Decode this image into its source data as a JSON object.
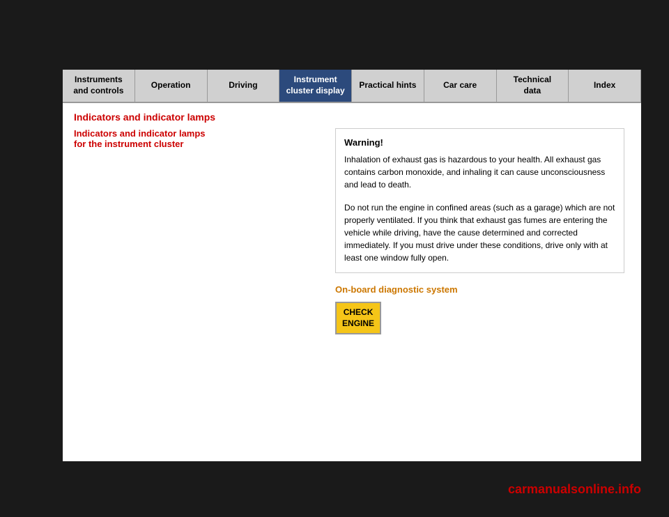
{
  "nav": {
    "items": [
      {
        "id": "instruments",
        "label": "Instruments\nand controls",
        "active": false
      },
      {
        "id": "operation",
        "label": "Operation",
        "active": false
      },
      {
        "id": "driving",
        "label": "Driving",
        "active": false
      },
      {
        "id": "instrument-cluster",
        "label": "Instrument\ncluster display",
        "active": true
      },
      {
        "id": "practical-hints",
        "label": "Practical hints",
        "active": false
      },
      {
        "id": "car-care",
        "label": "Car care",
        "active": false
      },
      {
        "id": "technical-data",
        "label": "Technical\ndata",
        "active": false
      },
      {
        "id": "index",
        "label": "Index",
        "active": false
      }
    ]
  },
  "page": {
    "title": "Indicators and indicator lamps",
    "section_title": "Indicators and indicator lamps\nfor the instrument cluster",
    "warning": {
      "title": "Warning!",
      "paragraph1": "Inhalation of exhaust gas is hazardous to your health. All exhaust gas contains carbon monoxide, and inhaling it can cause unconsciousness and lead to death.",
      "paragraph2": "Do not run the engine in confined areas (such as a garage) which are not properly ventilated. If you think that exhaust gas fumes are entering the vehicle while driving, have the cause determined and corrected immediately. If you must drive under these conditions, drive only with at least one window fully open."
    },
    "diagnostics": {
      "title": "On-board diagnostic system",
      "button_line1": "CHECK",
      "button_line2": "ENGINE"
    }
  },
  "branding": {
    "text": "carmanualsonline",
    "suffix": ".info"
  }
}
